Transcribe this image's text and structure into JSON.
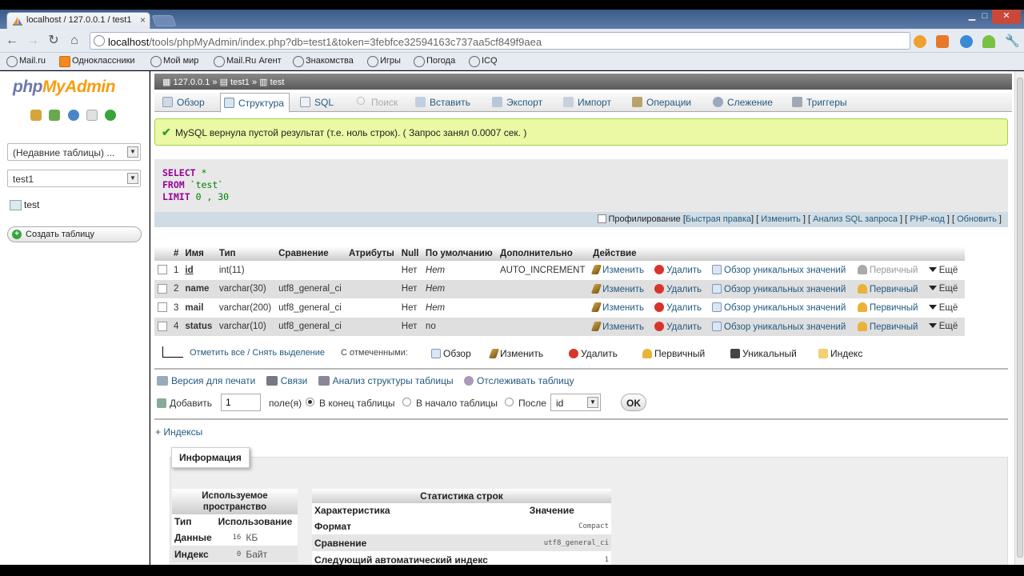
{
  "browser": {
    "tab_title": "localhost / 127.0.0.1 / test1",
    "tab_close": "×",
    "url_host": "localhost",
    "url_path": "/tools/phpMyAdmin/index.php?db=test1&token=3febfce32594163c737aa5cf849f9aea",
    "bookmarks": [
      "Mail.ru",
      "Одноклассники",
      "Мой мир",
      "Mail.Ru Агент",
      "Знакомства",
      "Игры",
      "Погода",
      "ICQ"
    ]
  },
  "left": {
    "logo_php": "php",
    "logo_my": "My",
    "logo_admin": "Admin",
    "recent_tables": "(Недавние таблицы) ...",
    "db_select": "test1",
    "table_name": "test",
    "create_table": "Создать таблицу"
  },
  "breadcrumb": {
    "server": "127.0.0.1",
    "sep1": "»",
    "db": "test1",
    "sep2": "»",
    "table": "test"
  },
  "tabs": [
    {
      "label": "Обзор"
    },
    {
      "label": "Структура"
    },
    {
      "label": "SQL"
    },
    {
      "label": "Поиск"
    },
    {
      "label": "Вставить"
    },
    {
      "label": "Экспорт"
    },
    {
      "label": "Импорт"
    },
    {
      "label": "Операции"
    },
    {
      "label": "Слежение"
    },
    {
      "label": "Триггеры"
    }
  ],
  "notice": {
    "check": "✔",
    "text": "MySQL вернула пустой результат (т.е. ноль строк). ( Запрос занял 0.0007 сек. )"
  },
  "sql": {
    "select": "SELECT",
    "star": "*",
    "from": "FROM",
    "table": "`test`",
    "limit": "LIMIT",
    "limit_vals": "0 , 30",
    "profiling": "Профилирование",
    "link_quick_edit": "Быстрая правка",
    "link_edit": "Изменить",
    "link_analyze": "Анализ SQL запроса",
    "link_php": "PHP-код",
    "link_refresh": "Обновить"
  },
  "structure": {
    "headers": [
      "#",
      "Имя",
      "Тип",
      "Сравнение",
      "Атрибуты",
      "Null",
      "По умолчанию",
      "Дополнительно",
      "Действие"
    ],
    "rows": [
      {
        "n": "1",
        "name": "id",
        "type": "int(11)",
        "collation": "",
        "null": "Нет",
        "default": "Нет",
        "extra": "AUTO_INCREMENT"
      },
      {
        "n": "2",
        "name": "name",
        "type": "varchar(30)",
        "collation": "utf8_general_ci",
        "null": "Нет",
        "default": "Нет",
        "extra": ""
      },
      {
        "n": "3",
        "name": "mail",
        "type": "varchar(200)",
        "collation": "utf8_general_ci",
        "null": "Нет",
        "default": "Нет",
        "extra": ""
      },
      {
        "n": "4",
        "name": "status",
        "type": "varchar(10)",
        "collation": "utf8_general_ci",
        "null": "Нет",
        "default": "no",
        "extra": ""
      }
    ],
    "actions": {
      "edit": "Изменить",
      "delete": "Удалить",
      "unique": "Обзор уникальных значений",
      "primary": "Первичный",
      "more": "Ещё"
    }
  },
  "with_selected": {
    "check_all": "Отметить все / Снять выделение",
    "with_selected": "С отмеченными:",
    "browse": "Обзор",
    "edit": "Изменить",
    "delete": "Удалить",
    "primary": "Первичный",
    "unique": "Уникальный",
    "index": "Индекс"
  },
  "struct_links": {
    "print": "Версия для печати",
    "relations": "Связи",
    "analyze": "Анализ структуры таблицы",
    "track": "Отслеживать таблицу"
  },
  "add_row": {
    "add": "Добавить",
    "count": "1",
    "fields": "поле(я)",
    "at_end": "В конец таблицы",
    "at_start": "В начало таблицы",
    "after": "После",
    "after_col": "id",
    "ok": "OK"
  },
  "indexes_link": "+ Индексы",
  "info": {
    "legend": "Информация",
    "space": {
      "title": "Используемое пространство",
      "col_type": "Тип",
      "col_usage": "Использование",
      "rows": [
        {
          "label": "Данные",
          "value": "16",
          "unit": "КБ"
        },
        {
          "label": "Индекс",
          "value": "0",
          "unit": "Байт"
        }
      ]
    },
    "stats": {
      "title": "Статистика строк",
      "col_char": "Характеристика",
      "col_value": "Значение",
      "rows": [
        {
          "label": "Формат",
          "value": "Compact"
        },
        {
          "label": "Сравнение",
          "value": "utf8_general_ci"
        },
        {
          "label": "Следующий автоматический индекс",
          "value": "1"
        }
      ]
    }
  }
}
